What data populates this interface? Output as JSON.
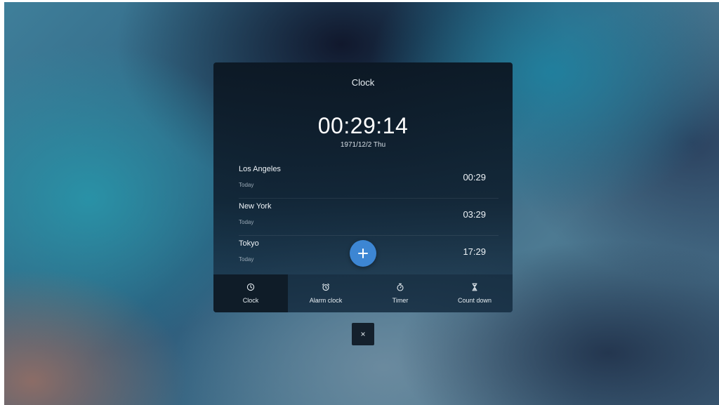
{
  "panel": {
    "title": "Clock",
    "time": "00:29:14",
    "date": "1971/12/2 Thu"
  },
  "cities": [
    {
      "name": "Los Angeles",
      "day": "Today",
      "time": "00:29"
    },
    {
      "name": "New York",
      "day": "Today",
      "time": "03:29"
    },
    {
      "name": "Tokyo",
      "day": "Today",
      "time": "17:29"
    }
  ],
  "tabs": [
    {
      "label": "Clock",
      "icon": "clock-icon",
      "selected": true
    },
    {
      "label": "Alarm clock",
      "icon": "alarm-clock-icon",
      "selected": false
    },
    {
      "label": "Timer",
      "icon": "stopwatch-icon",
      "selected": false
    },
    {
      "label": "Count down",
      "icon": "hourglass-icon",
      "selected": false
    }
  ],
  "add_button": {
    "icon": "plus-icon"
  },
  "close_button": {
    "label": "×",
    "icon": "close-icon"
  },
  "colors": {
    "accent": "#3d86d3",
    "panel_bg": "#0f1c28",
    "selected_tab_bg": "#0f1c28"
  }
}
